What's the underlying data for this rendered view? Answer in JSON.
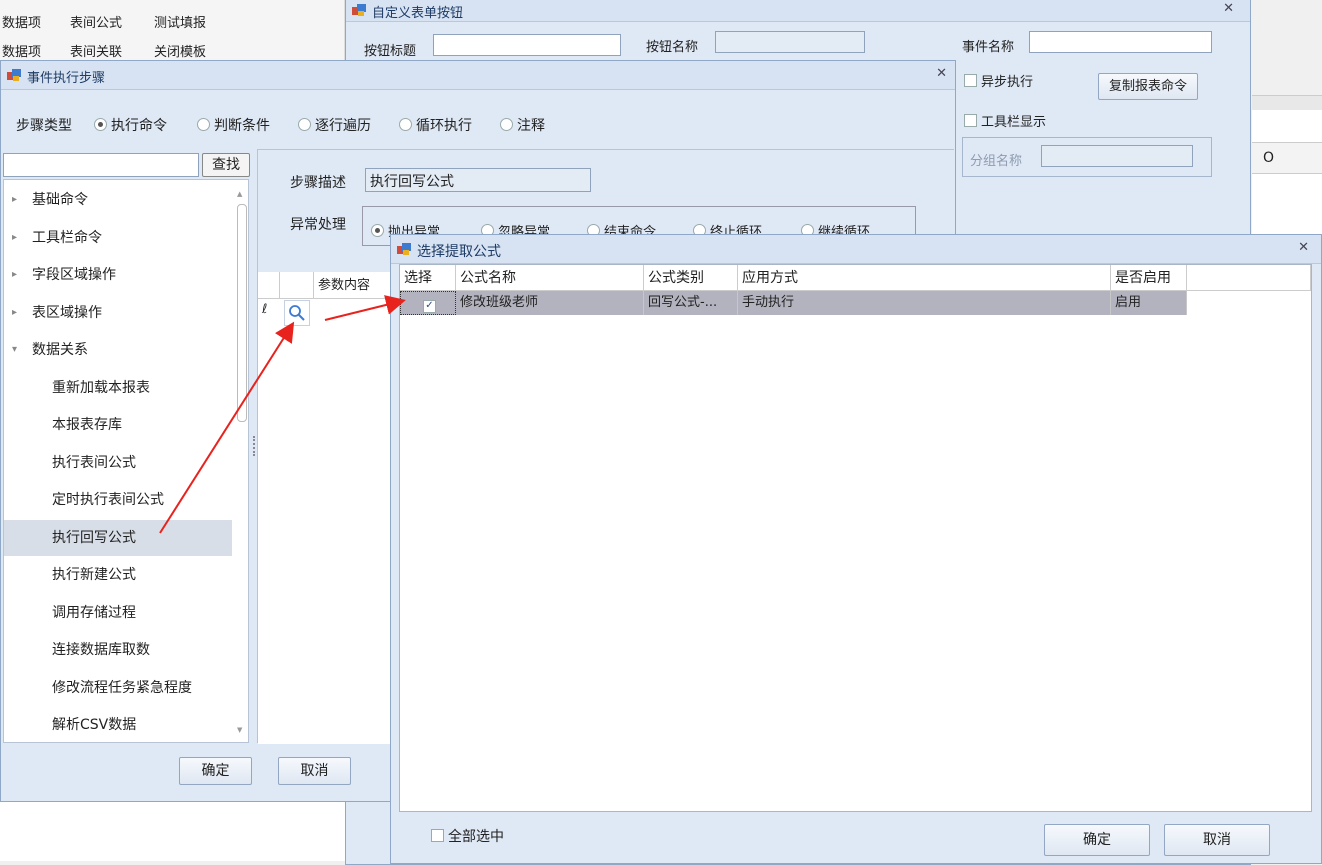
{
  "background_toolbar": {
    "row1": [
      "数据项",
      "表间公式",
      "测试填报"
    ],
    "row2": [
      "数据项",
      "表间关联",
      "关闭模板"
    ],
    "right_col_label": "O"
  },
  "custom_button_window": {
    "title": "自定义表单按钮",
    "button_title_label": "按钮标题",
    "button_title_value": "",
    "button_name_label": "按钮名称",
    "button_name_value": "",
    "event_name_label": "事件名称",
    "event_name_value": "",
    "async_label": "异步执行",
    "copy_cmd_label": "复制报表命令",
    "toolbar_show_label": "工具栏显示",
    "group_name_label": "分组名称",
    "group_name_value": ""
  },
  "event_window": {
    "title": "事件执行步骤",
    "step_type_label": "步骤类型",
    "step_types": [
      "执行命令",
      "判断条件",
      "逐行遍历",
      "循环执行",
      "注释"
    ],
    "search_value": "",
    "search_button": "查找",
    "tree_items": [
      {
        "label": "基础命令",
        "arrow": "▸"
      },
      {
        "label": "工具栏命令",
        "arrow": "▸"
      },
      {
        "label": "字段区域操作",
        "arrow": "▸"
      },
      {
        "label": "表区域操作",
        "arrow": "▸"
      },
      {
        "label": "数据关系",
        "arrow": "▾"
      },
      {
        "label": "重新加载本报表",
        "arrow": ""
      },
      {
        "label": "本报表存库",
        "arrow": ""
      },
      {
        "label": "执行表间公式",
        "arrow": ""
      },
      {
        "label": "定时执行表间公式",
        "arrow": ""
      },
      {
        "label": "执行回写公式",
        "arrow": ""
      },
      {
        "label": "执行新建公式",
        "arrow": ""
      },
      {
        "label": "调用存储过程",
        "arrow": ""
      },
      {
        "label": "连接数据库取数",
        "arrow": ""
      },
      {
        "label": "修改流程任务紧急程度",
        "arrow": ""
      },
      {
        "label": "解析CSV数据",
        "arrow": ""
      }
    ],
    "step_desc_label": "步骤描述",
    "step_desc_value": "执行回写公式",
    "exception_label": "异常处理",
    "exception_options": [
      "抛出异常",
      "忽略异常",
      "结束命令",
      "终止循环",
      "继续循环"
    ],
    "param_header": "参数内容",
    "ok_button": "确定",
    "cancel_button": "取消"
  },
  "select_formula_window": {
    "title": "选择提取公式",
    "columns": [
      "选择",
      "公式名称",
      "公式类别",
      "应用方式",
      "是否启用"
    ],
    "rows": [
      {
        "checked": true,
        "name": "修改班级老师",
        "category": "回写公式-...",
        "mode": "手动执行",
        "enabled": "启用"
      }
    ],
    "select_all_label": "全部选中",
    "ok_button": "确定",
    "cancel_button": "取消"
  },
  "colors": {
    "window_bg": "#dfe8f5",
    "titlebar": "#d7e3f2",
    "selected_row": "#b3b3bf",
    "arrow": "#e8231e"
  }
}
